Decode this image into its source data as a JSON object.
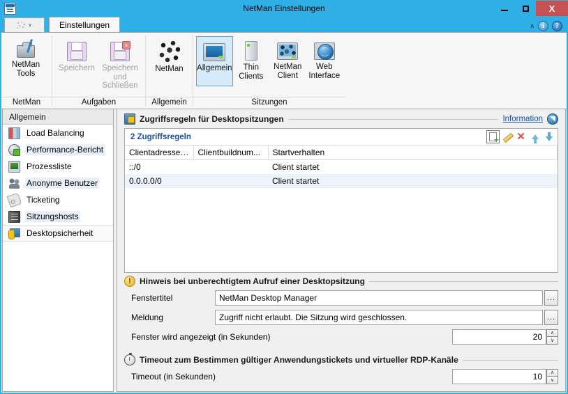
{
  "window": {
    "title": "NetMan Einstellungen",
    "icon": "app-icon",
    "buttons": {
      "minimize": "–",
      "maximize": "□",
      "close": "X"
    }
  },
  "ribbon": {
    "quick_access": {
      "icon": "netman-dots-icon",
      "caret": "∨"
    },
    "tabs": [
      {
        "label": "Einstellungen",
        "active": true
      }
    ],
    "right_tools": {
      "collapse": "∧",
      "info_icon": "i",
      "help_icon": "?"
    },
    "groups": [
      {
        "label": "NetMan",
        "items": [
          {
            "label_top": "NetMan",
            "label_bottom": "Tools",
            "icon": "toolbox-icon",
            "state": "enabled"
          }
        ]
      },
      {
        "label": "Aufgaben",
        "items": [
          {
            "label_top": "Speichern",
            "label_bottom": "",
            "icon": "floppy-save-icon",
            "state": "disabled"
          },
          {
            "label_top": "Speichern",
            "label_bottom": "und Schließen",
            "icon": "floppy-save-close-icon",
            "state": "disabled"
          }
        ]
      },
      {
        "label": "Allgemein",
        "items": [
          {
            "label_top": "NetMan",
            "label_bottom": "",
            "icon": "network-nodes-icon",
            "state": "enabled"
          }
        ]
      },
      {
        "label": "Sitzungen",
        "items": [
          {
            "label_top": "Allgemein",
            "label_bottom": "",
            "icon": "monitor-icon",
            "state": "selected"
          },
          {
            "label_top": "Thin",
            "label_bottom": "Clients",
            "icon": "thin-client-icon",
            "state": "enabled"
          },
          {
            "label_top": "NetMan",
            "label_bottom": "Client",
            "icon": "netman-client-icon",
            "state": "enabled"
          },
          {
            "label_top": "Web",
            "label_bottom": "Interface",
            "icon": "web-interface-icon",
            "state": "enabled"
          }
        ]
      }
    ]
  },
  "sidebar": {
    "header": "Allgemein",
    "items": [
      {
        "label": "Load Balancing",
        "icon": "load-balancing-icon"
      },
      {
        "label": "Performance-Bericht",
        "icon": "performance-report-icon"
      },
      {
        "label": "Prozessliste",
        "icon": "process-list-icon"
      },
      {
        "label": "Anonyme Benutzer",
        "icon": "anonymous-users-icon"
      },
      {
        "label": "Ticketing",
        "icon": "ticketing-icon"
      },
      {
        "label": "Sitzungshosts",
        "icon": "session-hosts-icon"
      },
      {
        "label": "Desktopsicherheit",
        "icon": "desktop-security-icon"
      }
    ]
  },
  "content": {
    "rules_section": {
      "icon": "monitor-lock-icon",
      "title": "Zugriffsregeln für Desktopsitzungen",
      "link": "Information",
      "badge_icon": "navigate-icon",
      "count_label": "2 Zugriffsregeln",
      "toolbar_buttons": [
        {
          "name": "new-rule-button",
          "icon": "new-page-icon"
        },
        {
          "name": "edit-rule-button",
          "icon": "pencil-icon"
        },
        {
          "name": "delete-rule-button",
          "icon": "red-x-icon"
        },
        {
          "name": "move-up-button",
          "icon": "arrow-up-icon"
        },
        {
          "name": "move-down-button",
          "icon": "arrow-down-icon"
        }
      ],
      "columns": [
        "Clientadresse/IP",
        "Clientbuildnum...",
        "Startverhalten"
      ],
      "rows": [
        {
          "address": "::/0",
          "build": "",
          "behavior": "Client startet"
        },
        {
          "address": "0.0.0.0/0",
          "build": "",
          "behavior": "Client startet"
        }
      ]
    },
    "notice_section": {
      "icon": "warning-icon",
      "title": "Hinweis bei unberechtigtem Aufruf einer Desktopsitzung",
      "fields": [
        {
          "label": "Fenstertitel",
          "value": "NetMan Desktop Manager",
          "placeholder": "",
          "button": "...",
          "name": "window-title-field"
        },
        {
          "label": "Meldung",
          "value": "Zugriff nicht erlaubt. Die Sitzung wird geschlossen.",
          "placeholder": "",
          "button": "...",
          "name": "message-field"
        }
      ],
      "spinner": {
        "label": "Fenster wird angezeigt (in Sekunden)",
        "value": "20",
        "up": "∧",
        "down": "∨"
      }
    },
    "timeout_section": {
      "icon": "stopwatch-icon",
      "title": "Timeout zum Bestimmen gültiger Anwendungstickets und virtueller RDP-Kanäle",
      "spinner": {
        "label": "Timeout (in Sekunden)",
        "value": "10",
        "up": "∧",
        "down": "∨"
      }
    }
  },
  "colors": {
    "titlebar": "#2eb0e6",
    "close_button": "#c75050",
    "accent_link": "#1a4fa0",
    "selection": "#d7ecfb",
    "row_alt": "#eef4fc"
  }
}
